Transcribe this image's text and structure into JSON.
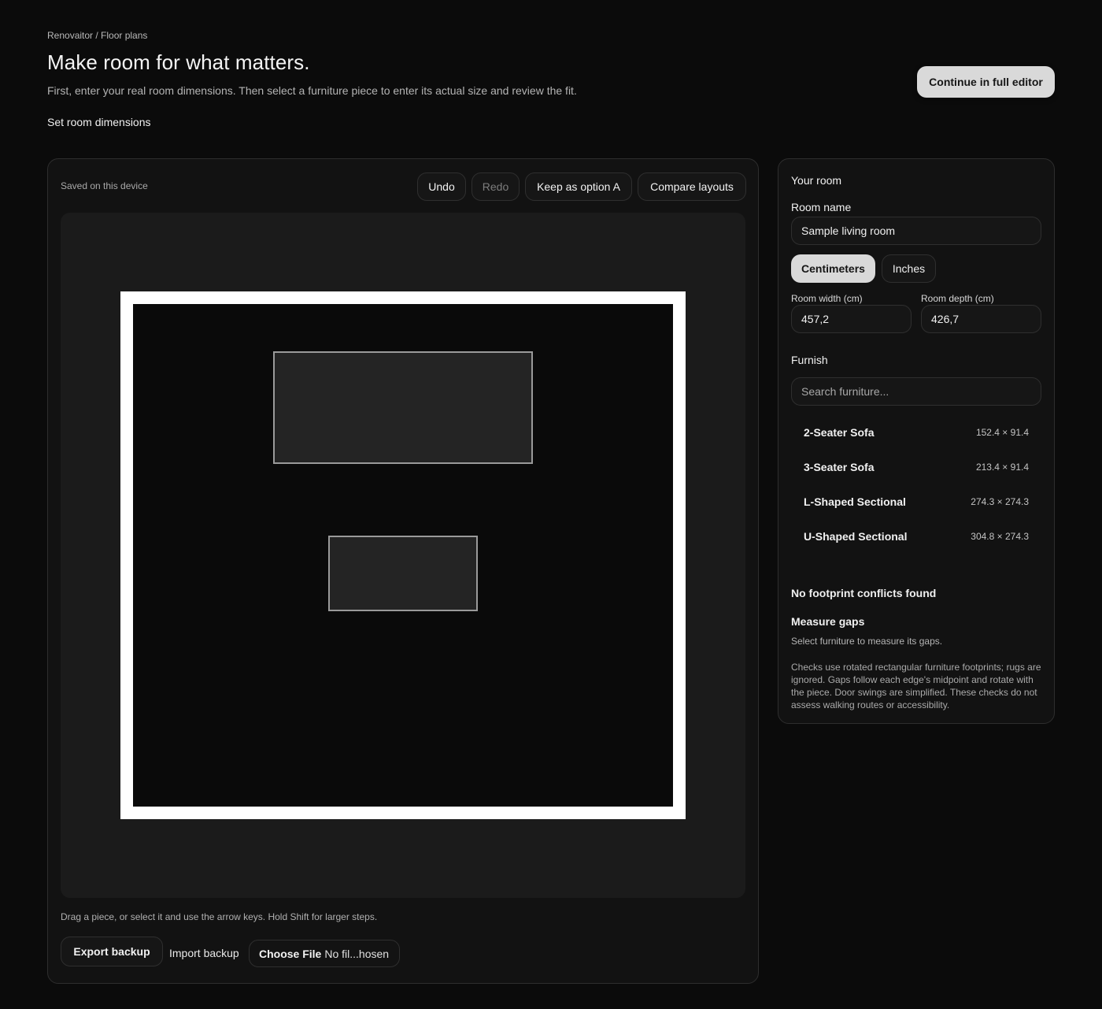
{
  "breadcrumb": "Renovaitor / Floor plans",
  "page_title": "Make room for what matters.",
  "subtitle": "First, enter your real room dimensions. Then select a furniture piece to enter its actual size and review the fit.",
  "set_room_label": "Set room dimensions",
  "continue_label": "Continue in full editor",
  "editor": {
    "saved_status": "Saved on this device",
    "undo_label": "Undo",
    "redo_label": "Redo",
    "keep_option_label": "Keep as option A",
    "compare_label": "Compare layouts",
    "hint": "Drag a piece, or select it and use the arrow keys. Hold Shift for larger steps.",
    "export_label": "Export backup",
    "import_label": "Import backup",
    "choose_file_label": "Choose File",
    "no_file_label": "No fil...hosen"
  },
  "side": {
    "your_room": "Your room",
    "room_name_label": "Room name",
    "room_name_value": "Sample living room",
    "units": [
      "Centimeters",
      "Inches"
    ],
    "active_unit": "Centimeters",
    "width_label": "Room width (cm)",
    "width_value": "457,2",
    "depth_label": "Room depth (cm)",
    "depth_value": "426,7",
    "furnish_title": "Furnish",
    "search_placeholder": "Search furniture...",
    "furniture": [
      {
        "name": "2-Seater Sofa",
        "size": "152.4 × 91.4"
      },
      {
        "name": "3-Seater Sofa",
        "size": "213.4 × 91.4"
      },
      {
        "name": "L-Shaped Sectional",
        "size": "274.3 × 274.3"
      },
      {
        "name": "U-Shaped Sectional",
        "size": "304.8 × 274.3"
      }
    ],
    "conflicts": "No footprint conflicts found",
    "gaps_title": "Measure gaps",
    "gaps_help": "Select furniture to measure its gaps.",
    "disclaimer": "Checks use rotated rectangular furniture footprints; rugs are ignored. Gaps follow each edge's midpoint and rotate with the piece. Door swings are simplified. These checks do not assess walking routes or accessibility."
  },
  "colors": {
    "background": "#0b0b0b",
    "panel": "#121212",
    "canvas": "#1b1b1b",
    "wall": "#ffffff",
    "primary_button": "#d9d9d9"
  }
}
